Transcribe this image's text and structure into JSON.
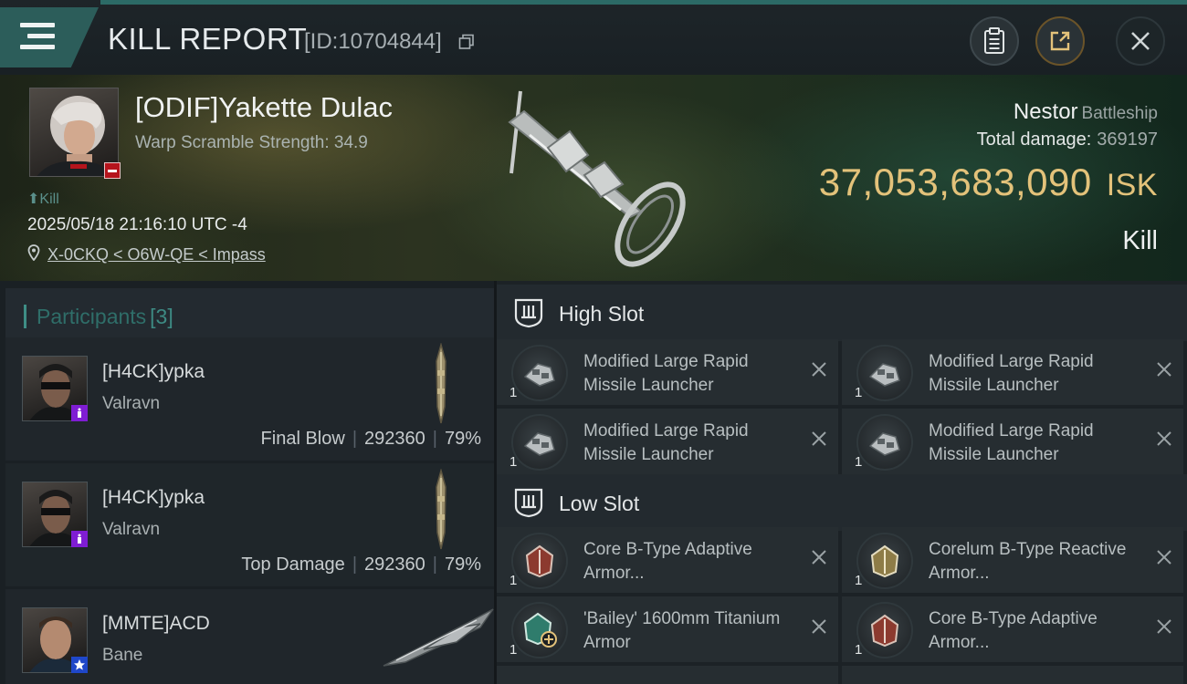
{
  "header": {
    "title": "KILL REPORT",
    "report_id": "[ID:10704844]",
    "icons": [
      "menu-icon",
      "copy-icon",
      "clipboard-icon",
      "share-icon",
      "close-icon"
    ]
  },
  "victim": {
    "name": "[ODIF]Yakette Dulac",
    "warp_scramble": "Warp Scramble Strength: 34.9",
    "kill_tag": "Kill",
    "datetime": "2025/05/18 21:16:10 UTC -4",
    "location": "X-0CKQ < O6W-QE < Impass"
  },
  "ship": {
    "name": "Nestor",
    "class": "Battleship",
    "total_damage_label": "Total damage:",
    "total_damage": "369197",
    "value": "37,053,683,090",
    "currency": "ISK",
    "result": "Kill"
  },
  "participants": {
    "title": "Participants",
    "count": "[3]",
    "list": [
      {
        "name": "[H4CK]ypka",
        "ship": "Valravn",
        "role": "Final Blow",
        "damage": "292360",
        "percent": "79%"
      },
      {
        "name": "[H4CK]ypka",
        "ship": "Valravn",
        "role": "Top Damage",
        "damage": "292360",
        "percent": "79%"
      },
      {
        "name": "[MMTE]ACD",
        "ship": "Bane"
      }
    ],
    "separator": "|"
  },
  "slots": {
    "high": {
      "label": "High Slot",
      "items": [
        {
          "name": "Modified Large Rapid Missile Launcher",
          "qty": "1"
        },
        {
          "name": "Modified Large Rapid Missile Launcher",
          "qty": "1"
        },
        {
          "name": "Modified Large Rapid Missile Launcher",
          "qty": "1"
        },
        {
          "name": "Modified Large Rapid Missile Launcher",
          "qty": "1"
        }
      ]
    },
    "low": {
      "label": "Low Slot",
      "items": [
        {
          "name": "Core B-Type Adaptive Armor...",
          "qty": "1"
        },
        {
          "name": "Corelum B-Type Reactive Armor...",
          "qty": "1"
        },
        {
          "name": "'Bailey' 1600mm Titanium Armor",
          "qty": "1"
        },
        {
          "name": "Core B-Type Adaptive Armor...",
          "qty": "1"
        }
      ]
    }
  },
  "colors": {
    "accent": "#3e8e86",
    "isk": "#e3c27a",
    "faction_badge": "#b5141c",
    "purple_badge": "#7f1dd3",
    "blue_badge": "#1f47c9"
  }
}
